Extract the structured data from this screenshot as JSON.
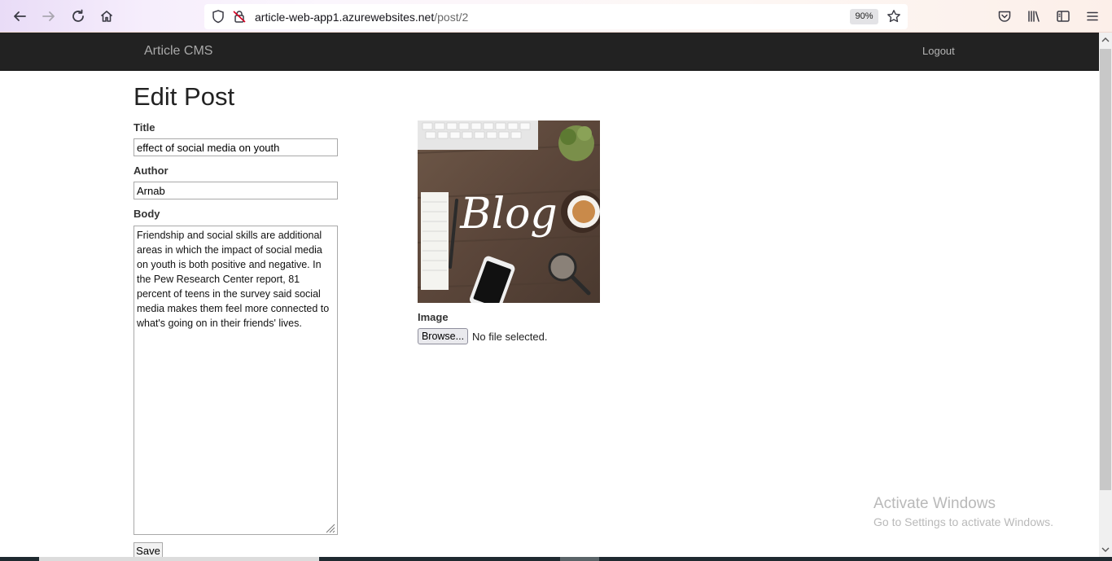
{
  "browser": {
    "url_host": "article-web-app1.azurewebsites.net",
    "url_path": "/post/2",
    "zoom": "90%"
  },
  "nav": {
    "brand": "Article CMS",
    "logout": "Logout"
  },
  "form": {
    "heading": "Edit Post",
    "title_label": "Title",
    "title_value": "effect of social media on youth",
    "author_label": "Author",
    "author_value": "Arnab",
    "body_label": "Body",
    "body_value": "Friendship and social skills are additional areas in which the impact of social media on youth is both positive and negative. In the Pew Research Center report, 81 percent of teens in the survey said social media makes them feel more connected to what's going on in their friends' lives.",
    "image_label": "Image",
    "browse_label": "Browse...",
    "file_status": "No file selected.",
    "save_label": "Save"
  },
  "post_image": {
    "text": "Blog"
  },
  "watermark": {
    "title": "Activate Windows",
    "subtitle": "Go to Settings to activate Windows."
  },
  "icons": {
    "toolbar": [
      "back-icon",
      "forward-icon",
      "reload-icon",
      "home-icon",
      "shield-icon",
      "insecure-lock-icon",
      "bookmark-star-icon",
      "pocket-icon",
      "library-icon",
      "sidebar-icon",
      "menu-icon"
    ]
  }
}
